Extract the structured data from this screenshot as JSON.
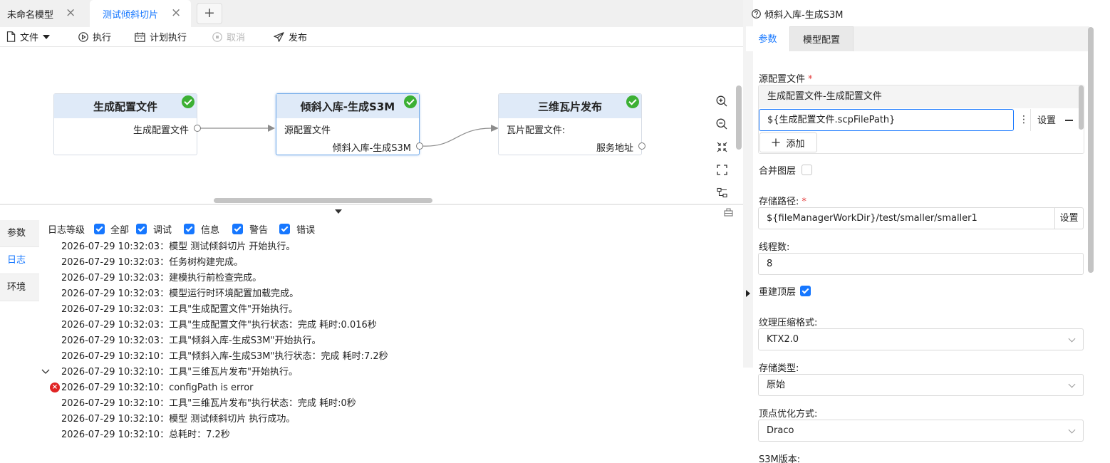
{
  "tabs": [
    {
      "label": "未命名模型",
      "active": false
    },
    {
      "label": "测试倾斜切片",
      "active": true
    }
  ],
  "toolbar": {
    "file": "文件",
    "run": "执行",
    "schedule": "计划执行",
    "cancel": "取消",
    "publish": "发布"
  },
  "nodes": [
    {
      "title": "生成配置文件",
      "inputs": [],
      "outputs": [
        "生成配置文件"
      ],
      "status": "success"
    },
    {
      "title": "倾斜入库-生成S3M",
      "inputs": [
        "源配置文件"
      ],
      "outputs": [
        "倾斜入库-生成S3M"
      ],
      "status": "success",
      "selected": true
    },
    {
      "title": "三维瓦片发布",
      "inputs": [
        "瓦片配置文件:"
      ],
      "outputs": [
        "服务地址"
      ],
      "status": "success"
    }
  ],
  "bottom_tabs": [
    "参数",
    "日志",
    "环境"
  ],
  "log_level": {
    "label": "日志等级",
    "options": [
      {
        "label": "全部",
        "checked": true
      },
      {
        "label": "调试",
        "checked": true
      },
      {
        "label": "信息",
        "checked": true
      },
      {
        "label": "警告",
        "checked": true
      },
      {
        "label": "错误",
        "checked": true
      }
    ]
  },
  "logs": [
    "2026-07-29 10:32:03：模型 测试倾斜切片 开始执行。",
    "2026-07-29 10:32:03：任务树构建完成。",
    "2026-07-29 10:32:03：建模执行前检查完成。",
    "2026-07-29 10:32:03：模型运行时环境配置加载完成。",
    "2026-07-29 10:32:03：工具\"生成配置文件\"开始执行。",
    "2026-07-29 10:32:03：工具\"生成配置文件\"执行状态：完成   耗时:0.016秒",
    "2026-07-29 10:32:03：工具\"倾斜入库-生成S3M\"开始执行。",
    "2026-07-29 10:32:10：工具\"倾斜入库-生成S3M\"执行状态：完成   耗时:7.2秒",
    "2026-07-29 10:32:10：工具\"三维瓦片发布\"开始执行。",
    "2026-07-29 10:32:10：configPath is error",
    "2026-07-29 10:32:10：工具\"三维瓦片发布\"执行状态：完成   耗时:0秒",
    "2026-07-29 10:32:10：模型 测试倾斜切片 执行成功。",
    "2026-07-29 10:32:10：总耗时：7.2秒"
  ],
  "panel": {
    "title": "倾斜入库-生成S3M",
    "tabs": [
      "参数",
      "模型配置"
    ],
    "source_label": "源配置文件",
    "source_head": "生成配置文件-生成配置文件",
    "source_value": "${生成配置文件.scpFilePath}",
    "set_label": "设置",
    "add_label": "添加",
    "merge_label": "合并图层",
    "merge_checked": false,
    "storage_label": "存储路径:",
    "storage_value": "${fileManagerWorkDir}/test/smaller/smaller1",
    "threads_label": "线程数:",
    "threads_value": "8",
    "rebuild_label": "重建顶层",
    "rebuild_checked": true,
    "texture_label": "纹理压缩格式:",
    "texture_value": "KTX2.0",
    "storetype_label": "存储类型:",
    "storetype_value": "原始",
    "vertex_label": "顶点优化方式:",
    "vertex_value": "Draco",
    "s3m_label": "S3M版本:"
  },
  "colors": {
    "accent": "#1677ff",
    "success": "#3cb034",
    "error": "#e02424",
    "node_head": "#dfeaf8"
  }
}
